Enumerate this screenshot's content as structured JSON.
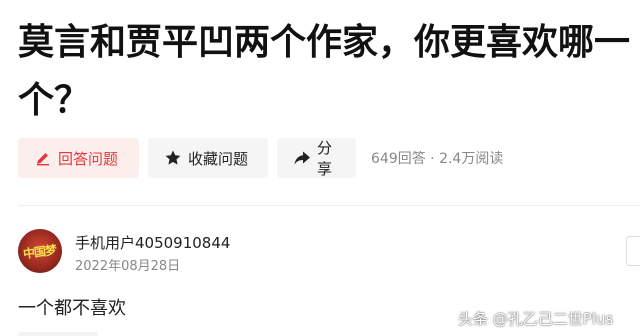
{
  "question": {
    "title": "莫言和贾平凹两个作家，你更喜欢哪一个？"
  },
  "actions": {
    "answer_label": "回答问题",
    "collect_label": "收藏问题",
    "share_label": "分享",
    "stats": "649回答 · 2.4万阅读"
  },
  "answer": {
    "avatar_text": "中国梦",
    "user_name": "手机用户4050910844",
    "date": "2022年08月28日",
    "content": "一个都不喜欢"
  },
  "watermark": {
    "text": "头条 @孔乙己二世Plus"
  },
  "colors": {
    "accent": "#e4393c",
    "answer_bg": "#fdeeee",
    "button_bg": "#f5f5f5",
    "muted_text": "#888888"
  },
  "icons": {
    "answer": "pencil-icon",
    "collect": "star-icon",
    "share": "share-arrow-icon"
  }
}
